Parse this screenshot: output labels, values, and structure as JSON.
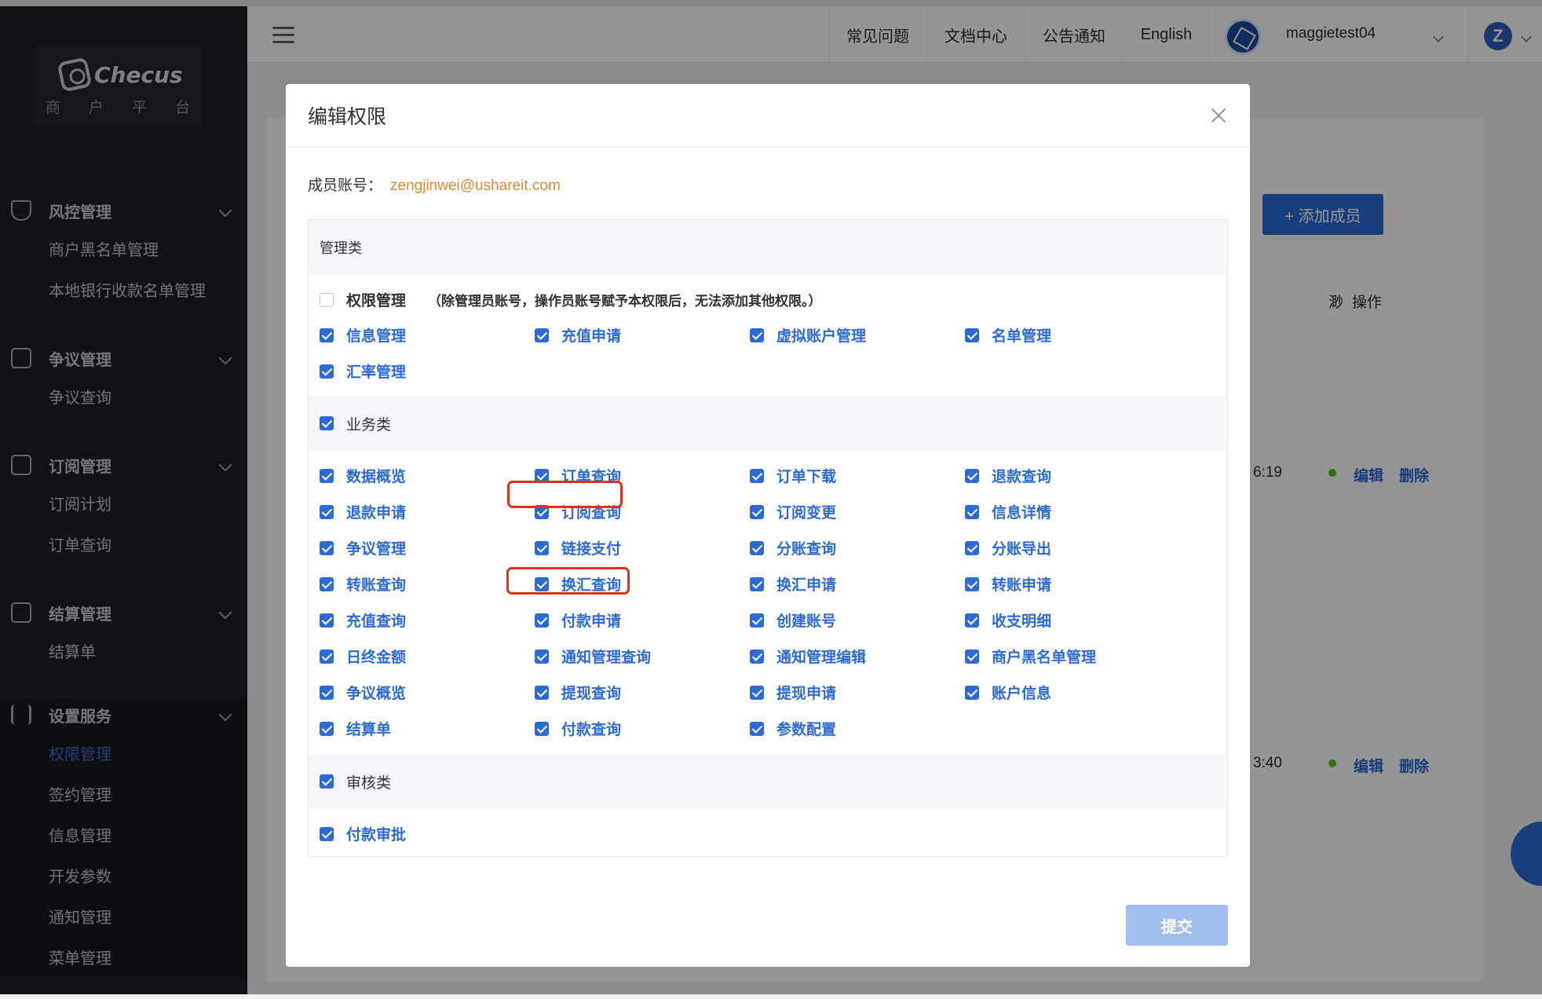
{
  "header": {
    "nav": [
      "常见问题",
      "文档中心",
      "公告通知",
      "English"
    ],
    "username": "maggietest04",
    "user_initial": "Z"
  },
  "sidebar": {
    "logo_text": "Checus",
    "logo_sub": [
      "商",
      "户",
      "平",
      "台"
    ],
    "groups": [
      {
        "label": "风控管理",
        "icon": "shield-icon",
        "items": [
          "商户黑名单管理",
          "本地银行收款名单管理"
        ]
      },
      {
        "label": "争议管理",
        "icon": "clipboard-icon",
        "items": [
          "争议查询"
        ]
      },
      {
        "label": "订阅管理",
        "icon": "calendar-icon",
        "items": [
          "订阅计划",
          "订单查询"
        ]
      },
      {
        "label": "结算管理",
        "icon": "receipt-icon",
        "items": [
          "结算单"
        ]
      },
      {
        "label": "设置服务",
        "icon": "sliders-icon",
        "items": [
          "权限管理",
          "签约管理",
          "信息管理",
          "开发参数",
          "通知管理",
          "菜单管理"
        ]
      }
    ],
    "active_item": "权限管理"
  },
  "background": {
    "add_member": "+ 添加成员",
    "col_ops": "操作",
    "col_status_partial": "渺",
    "rows": [
      {
        "time": "6:19",
        "edit": "编辑",
        "delete": "删除"
      },
      {
        "time": "3:40",
        "edit": "编辑",
        "delete": "删除"
      }
    ]
  },
  "modal": {
    "title": "编辑权限",
    "member_label": "成员账号：",
    "member_email": "zengjinwei@ushareit.com",
    "submit_label": "提交",
    "sections": [
      {
        "title": "管理类",
        "special": {
          "label": "权限管理",
          "checked": false,
          "note": "（除管理员账号，操作员账号赋予本权限后，无法添加其他权限。）"
        },
        "items": [
          "信息管理",
          "充值申请",
          "虚拟账户管理",
          "名单管理",
          "汇率管理"
        ]
      },
      {
        "title": "业务类",
        "checked": true,
        "items": [
          "数据概览",
          "订单查询",
          "订单下载",
          "退款查询",
          "退款申请",
          "订阅查询",
          "订阅变更",
          "信息详情",
          "争议管理",
          "链接支付",
          "分账查询",
          "分账导出",
          "转账查询",
          "换汇查询",
          "换汇申请",
          "转账申请",
          "充值查询",
          "付款申请",
          "创建账号",
          "收支明细",
          "日终金额",
          "通知管理查询",
          "通知管理编辑",
          "商户黑名单管理",
          "争议概览",
          "提现查询",
          "提现申请",
          "账户信息",
          "结算单",
          "付款查询",
          "参数配置"
        ]
      },
      {
        "title": "审核类",
        "checked": true,
        "items": [
          "付款审批"
        ]
      }
    ],
    "highlighted": [
      "付款申请",
      "付款查询"
    ]
  },
  "colors": {
    "accent": "#2d6ad7",
    "highlight": "#e0301e",
    "email": "#e6862e",
    "sidebar_bg": "#1f2127"
  }
}
